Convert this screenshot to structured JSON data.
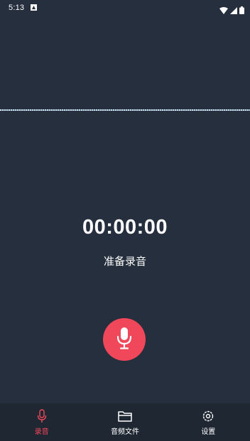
{
  "status_bar": {
    "time": "5:13"
  },
  "recorder": {
    "timer": "00:00:00",
    "status": "准备录音"
  },
  "bottom_nav": {
    "items": [
      {
        "label": "录音",
        "active": true
      },
      {
        "label": "音频文件",
        "active": false
      },
      {
        "label": "设置",
        "active": false
      }
    ]
  },
  "colors": {
    "background": "#252f3d",
    "nav_background": "#1f2733",
    "accent": "#f1475a",
    "waveform": "#d4e3f0"
  },
  "icons": {
    "record_button": "microphone-icon",
    "nav_record": "microphone-icon",
    "nav_files": "folder-icon",
    "nav_settings": "gear-icon"
  }
}
